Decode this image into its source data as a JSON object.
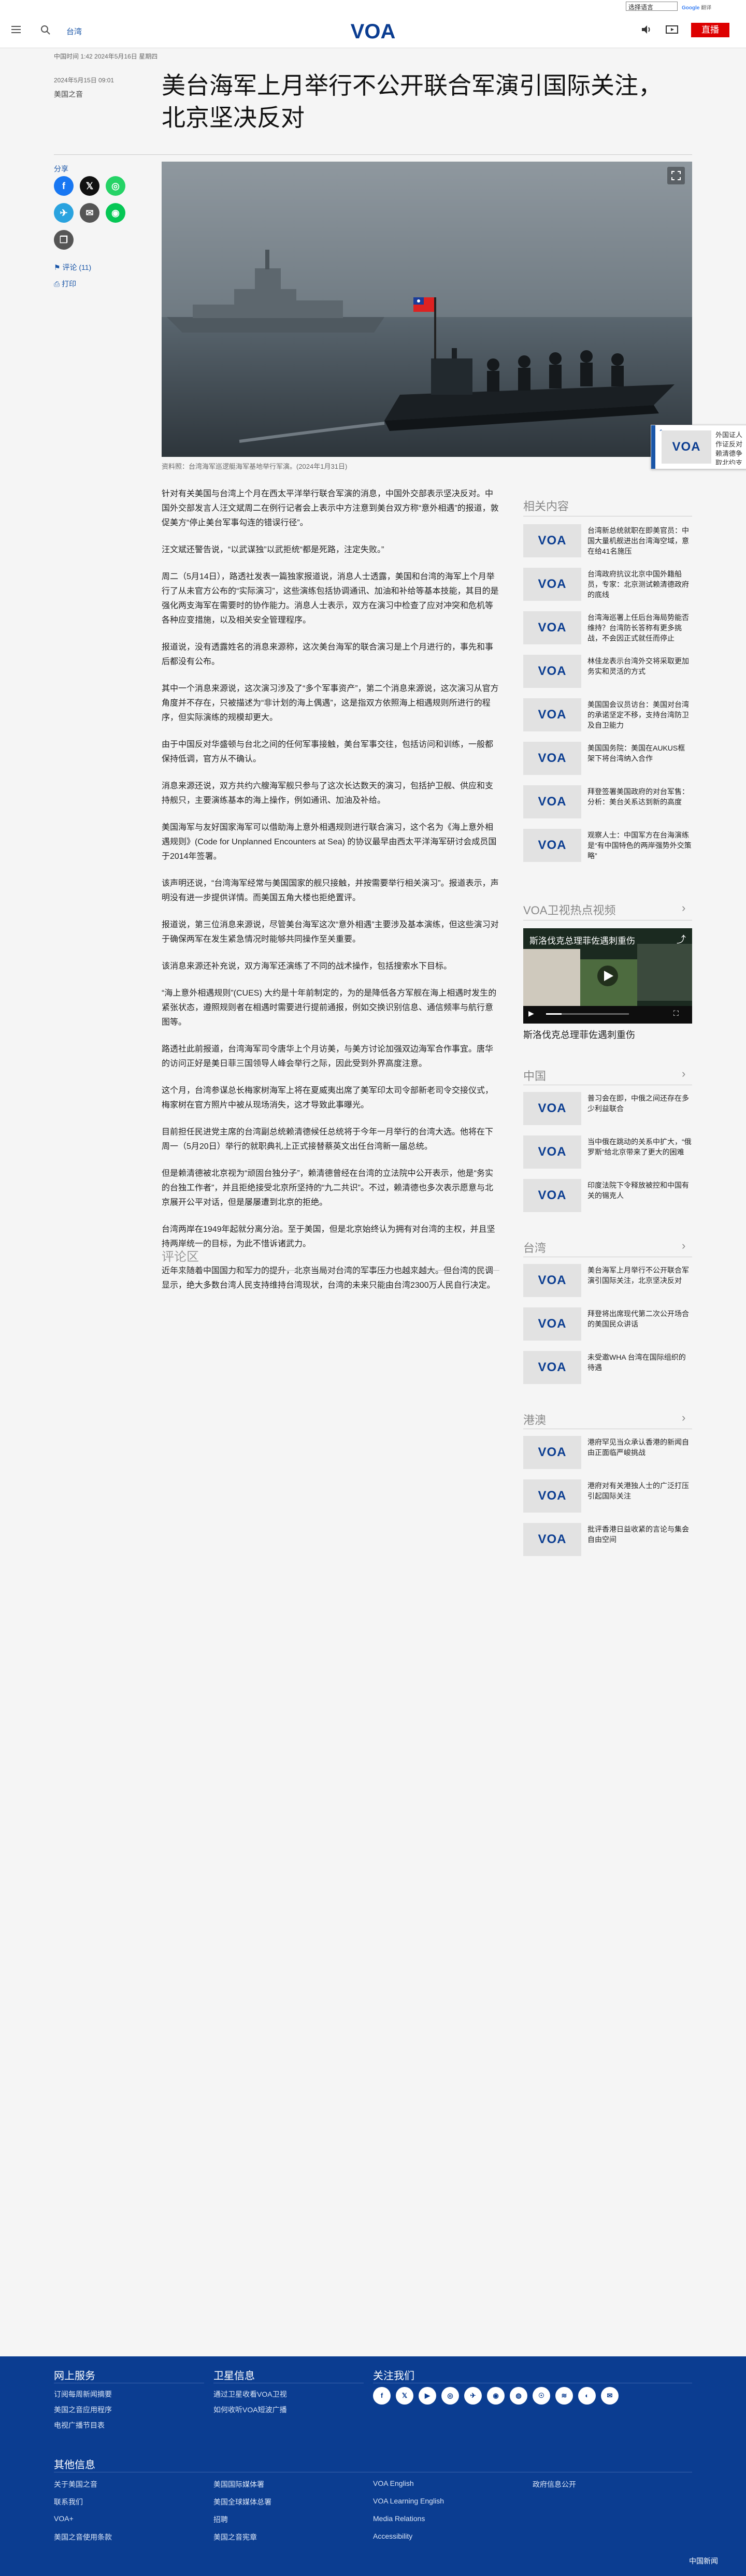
{
  "topbar": {
    "language_select": "选择语言",
    "translate_label": "Google",
    "translate_suffix": "翻译"
  },
  "header": {
    "section": "台湾",
    "logo_text": "VOA",
    "live_label": "直播"
  },
  "article": {
    "date_line": "中国时间 1:42 2024年5月16日 星期四",
    "published": "2024年5月15日 09:01",
    "byline": "美国之音",
    "title_lines": [
      "美台海军上月举行不公开联合军演引国际关注，",
      "北京坚决反对"
    ],
    "share_label": "分享",
    "comments_link": "评论 (11)",
    "print_link": "打印",
    "caption": "资料照：台湾海军巡逻艇海军基地举行军演。(2024年1月31日)",
    "paragraphs": [
      "针对有关美国与台湾上个月在西太平洋举行联合军演的消息，中国外交部表示坚决反对。中国外交部发言人汪文斌周二在例行记者会上表示中方注意到美台双方称“意外相遇”的报道，敦促美方“停止美台军事勾连的错误行径”。",
      "汪文斌还警告说，“以武谋独”以武拒统“都是死路，注定失败。”",
      "周二（5月14日），路透社发表一篇独家报道说，消息人士透露，美国和台湾的海军上个月举行了从未官方公布的“实际演习”，这些演练包括协调通讯、加油和补给等基本技能，其目的是强化两支海军在需要时的协作能力。消息人士表示，双方在演习中检查了应对冲突和危机等各种应变措施，以及相关安全管理程序。",
      "报道说，没有透露姓名的消息来源称，这次美台海军的联合演习是上个月进行的，事先和事后都没有公布。",
      "其中一个消息来源说，这次演习涉及了“多个军事资产”，第二个消息来源说，这次演习从官方角度并不存在，只被描述为“非计划的海上偶遇”，这是指双方依照海上相遇规则所进行的程序，但实际演练的规模却更大。",
      "由于中国反对华盛顿与台北之间的任何军事接触，美台军事交往，包括访问和训练，一般都保持低调，官方从不确认。",
      "消息来源还说，双方共约六艘海军舰只参与了这次长达数天的演习，包括护卫舰、供应和支持舰只，主要演练基本的海上操作，例如通讯、加油及补给。",
      "美国海军与友好国家海军可以借助海上意外相遇规则进行联合演习，这个名为《海上意外相遇规则》(Code for Unplanned Encounters at Sea) 的协议最早由西太平洋海军研讨会成员国于2014年签署。",
      "该声明还说，“台湾海军经常与美国国家的舰只接触，并按需要举行相关演习”。报道表示，声明没有进一步提供详情。而美国五角大楼也拒绝置评。",
      "报道说，第三位消息来源说，尽管美台海军这次“意外相遇”主要涉及基本演练，但这些演习对于确保两军在发生紧急情况时能够共同操作至关重要。",
      "该消息来源还补充说，双方海军还演练了不同的战术操作，包括搜索水下目标。",
      "“海上意外相遇规则”(CUES) 大约是十年前制定的，为的是降低各方军舰在海上相遇时发生的紧张状态，遵照规则者在相遇时需要进行提前通报，例如交换识别信息、通信频率与航行意图等。",
      "路透社此前报道，台湾海军司令唐华上个月访美，与美方讨论加强双边海军合作事宜。唐华的访问正好是美日菲三国领导人峰会举行之际，因此受到外界高度注意。",
      "这个月，台湾参谋总长梅家树海军上将在夏威夷出席了美军印太司令部新老司令交接仪式，梅家树在官方照片中被从现场消失，这才导致此事曝光。",
      "目前担任民进党主席的台湾副总统赖清德候任总统将于今年一月举行的台湾大选。他将在下周一（5月20日）举行的就职典礼上正式接替蔡英文出任台湾新一届总统。",
      "但是赖清德被北京视为“顽固台独分子”，赖清德曾经在台湾的立法院中公开表示，他是“务实的台独工作者”，并且拒绝接受北京所坚持的“九二共识”。不过，赖清德也多次表示愿意与北京展开公平对话，但是屡屡遭到北京的拒绝。",
      "台湾两岸在1949年起就分离分治。至于美国，但是北京始终认为拥有对台湾的主权，并且坚持两岸统一的目标，为此不惜诉诸武力。",
      "近年来随着中国国力和军力的提升，北京当局对台湾的军事压力也越来越大。但台湾的民调显示，绝大多数台湾人民支持维持台湾现状，台湾的未来只能由台湾2300万人民自行决定。"
    ],
    "comments_heading": "评论区"
  },
  "sidebar": {
    "related_heading": "相关内容",
    "related": [
      "台湾新总统就职在即美官员：中国大量机舰进出台湾海空域，意在给41名施压",
      "台湾政府抗议北京中国外籍船员，专家：北京测试赖清德政府的底线",
      "台湾海巡署上任后台海局势能否维持？台湾防长答称有更多挑战，不会因正式就任而停止",
      "林佳龙表示台湾外交将采取更加务实和灵活的方式",
      "美国国会议员访台：美国对台湾的承诺坚定不移，支持台湾防卫及自卫能力",
      "美国国务院：美国在AUKUS框架下将台湾纳入合作",
      "拜登签署美国政府的对台军售：分析：美台关系达到新的高度",
      "观察人士：中国军方在台海演练是“有中国特色的两岸强势外交策略”"
    ],
    "video_heading": "VOA卫视热点视频",
    "video_overlay": "斯洛伐克总理菲佐遇刺重伤",
    "video_title": "斯洛伐克总理菲佐遇刺重伤",
    "china_heading": "中国",
    "china_items": [
      "普习会在即，中俄之间还存在多少利益联合",
      "当中俄在跳动的关系中扩大，“俄罗斯”给北京带来了更大的困难",
      "印度法院下令释放被控和中国有关的锡克人"
    ],
    "taiwan_heading": "台湾",
    "taiwan_items": [
      "美台海军上月举行不公开联合军演引国际关注，北京坚决反对",
      "拜登将出席现代第二次公开场合的美国民众讲话",
      "未受邀WHA 台湾在国际组织的待遇"
    ],
    "hk_heading": "港澳",
    "hk_items": [
      "港府罕见当众承认香港的新闻自由正面临严峻挑战",
      "港府对有关港独人士的广泛打压引起国际关注",
      "批评香港日益收紧的言论与集会自由空间"
    ],
    "popout_text": "外国证人作证反对赖清德争取北约支持"
  },
  "footer": {
    "col1_heading": "网上服务",
    "col1_links": [
      "订阅每周新闻摘要",
      "美国之音应用程序",
      "电视广播节目表"
    ],
    "col2_heading": "卫星信息",
    "col2_links": [
      "通过卫星收看VOA卫视",
      "如何收听VOA短波广播"
    ],
    "col3_heading": "关注我们",
    "social": [
      "f",
      "𝕏",
      "▶",
      "◎",
      "✈",
      "◉",
      "◍",
      "☉",
      "≋",
      "◐",
      "✉"
    ],
    "other_heading": "其他信息",
    "other_links": [
      [
        "关于美国之音",
        "美国国际媒体署",
        "VOA English",
        "政府信息公开"
      ],
      [
        "联系我们",
        "美国全球媒体总署",
        "VOA Learning English",
        ""
      ],
      [
        "VOA+",
        "招聘",
        "Media Relations",
        ""
      ],
      [
        "美国之音使用条款",
        "美国之音宪章",
        "Accessibility",
        ""
      ]
    ],
    "brand": "中国新闻"
  },
  "colors": {
    "brand_blue": "#0b3d91",
    "live_red": "#dd0000",
    "link_blue": "#1a56a8"
  }
}
